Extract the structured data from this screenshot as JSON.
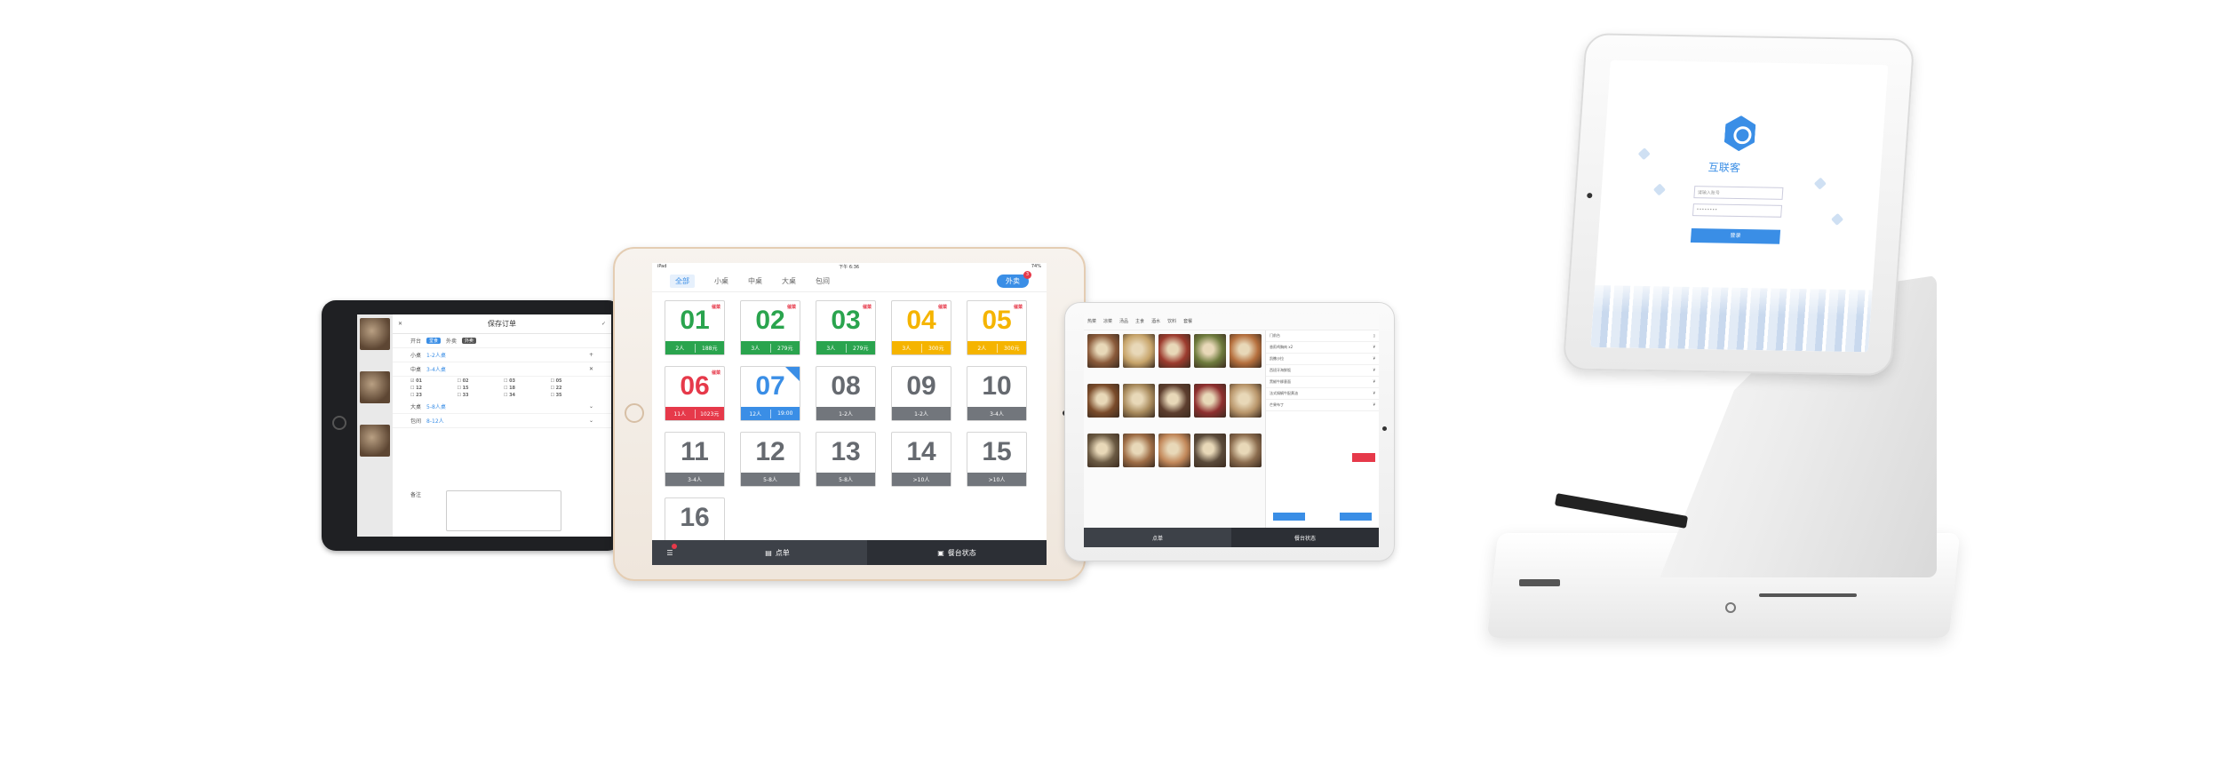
{
  "left_ipad": {
    "title": "保存订单",
    "mode_label": "开台",
    "mode_badge": "堂食",
    "takeout_label": "外卖",
    "takeout_badge": "外卖",
    "rows": [
      {
        "label": "小桌",
        "value": "1-2人桌"
      },
      {
        "label": "中桌",
        "value": "3-4人桌"
      }
    ],
    "table_numbers": [
      "01",
      "02",
      "03",
      "05",
      "12",
      "15",
      "18",
      "22",
      "23",
      "33",
      "34",
      "35"
    ],
    "rows2": [
      {
        "label": "大桌",
        "value": "5-8人桌"
      },
      {
        "label": "包间",
        "value": "8-12人"
      }
    ],
    "note_label": "备注"
  },
  "center_ipad": {
    "status": {
      "left": "iPad",
      "center": "下午 6:36",
      "right": "74%"
    },
    "tabs": [
      "全部",
      "小桌",
      "中桌",
      "大桌",
      "包间"
    ],
    "takeout_button": "外卖",
    "takeout_badge": "3",
    "tables": [
      {
        "num": "01",
        "color": "green",
        "people": "2人",
        "amount": "188元",
        "tag": "催菜"
      },
      {
        "num": "02",
        "color": "green",
        "people": "3人",
        "amount": "279元",
        "tag": "催菜"
      },
      {
        "num": "03",
        "color": "green",
        "people": "3人",
        "amount": "279元",
        "tag": "催菜"
      },
      {
        "num": "04",
        "color": "yellow",
        "people": "3人",
        "amount": "300元",
        "tag": "催菜"
      },
      {
        "num": "05",
        "color": "yellow",
        "people": "2人",
        "amount": "300元",
        "tag": "催菜"
      },
      {
        "num": "06",
        "color": "red",
        "people": "11人",
        "amount": "1023元",
        "tag": "催菜"
      },
      {
        "num": "07",
        "color": "blue",
        "people": "12人",
        "amount": "19:00",
        "tag": ""
      },
      {
        "num": "08",
        "color": "gray",
        "people": "1-2人",
        "amount": "",
        "tag": ""
      },
      {
        "num": "09",
        "color": "gray",
        "people": "1-2人",
        "amount": "",
        "tag": ""
      },
      {
        "num": "10",
        "color": "gray",
        "people": "3-4人",
        "amount": "",
        "tag": ""
      },
      {
        "num": "11",
        "color": "gray",
        "people": "3-4人",
        "amount": "",
        "tag": ""
      },
      {
        "num": "12",
        "color": "gray",
        "people": "5-8人",
        "amount": "",
        "tag": ""
      },
      {
        "num": "13",
        "color": "gray",
        "people": "5-8人",
        "amount": "",
        "tag": ""
      },
      {
        "num": "14",
        "color": "gray",
        "people": ">10人",
        "amount": "",
        "tag": ""
      },
      {
        "num": "15",
        "color": "gray",
        "people": ">10人",
        "amount": "",
        "tag": ""
      },
      {
        "num": "16",
        "color": "gray",
        "people": "",
        "amount": "",
        "tag": ""
      }
    ],
    "bottom": {
      "order": "点单",
      "table_status": "餐台状态"
    }
  },
  "right_ipad": {
    "categories": [
      "热菜",
      "凉菜",
      "汤品",
      "主食",
      "酒水",
      "饮料",
      "套餐"
    ],
    "order_title": "门前台",
    "order_items": [
      {
        "name": "香煎鸡胸肉 x2",
        "price": "¥"
      },
      {
        "name": "凯撒沙拉",
        "price": "¥"
      },
      {
        "name": "西班牙海鲜饭",
        "price": "¥"
      },
      {
        "name": "黑椒牛柳意面",
        "price": "¥"
      },
      {
        "name": "法式焗蜗牛配黄油",
        "price": "¥"
      },
      {
        "name": "芒果布丁",
        "price": "¥"
      }
    ],
    "bottom": {
      "order": "点单",
      "table_status": "餐台状态"
    }
  },
  "pos": {
    "app_name": "互联客",
    "account_placeholder": "请输入账号",
    "password_placeholder": "••••••••",
    "login_button": "登录"
  },
  "colors": {
    "green": "#2aa44e",
    "yellow": "#f5b400",
    "red": "#e6394a",
    "blue": "#3a8ee6",
    "gray": "#72767c"
  }
}
